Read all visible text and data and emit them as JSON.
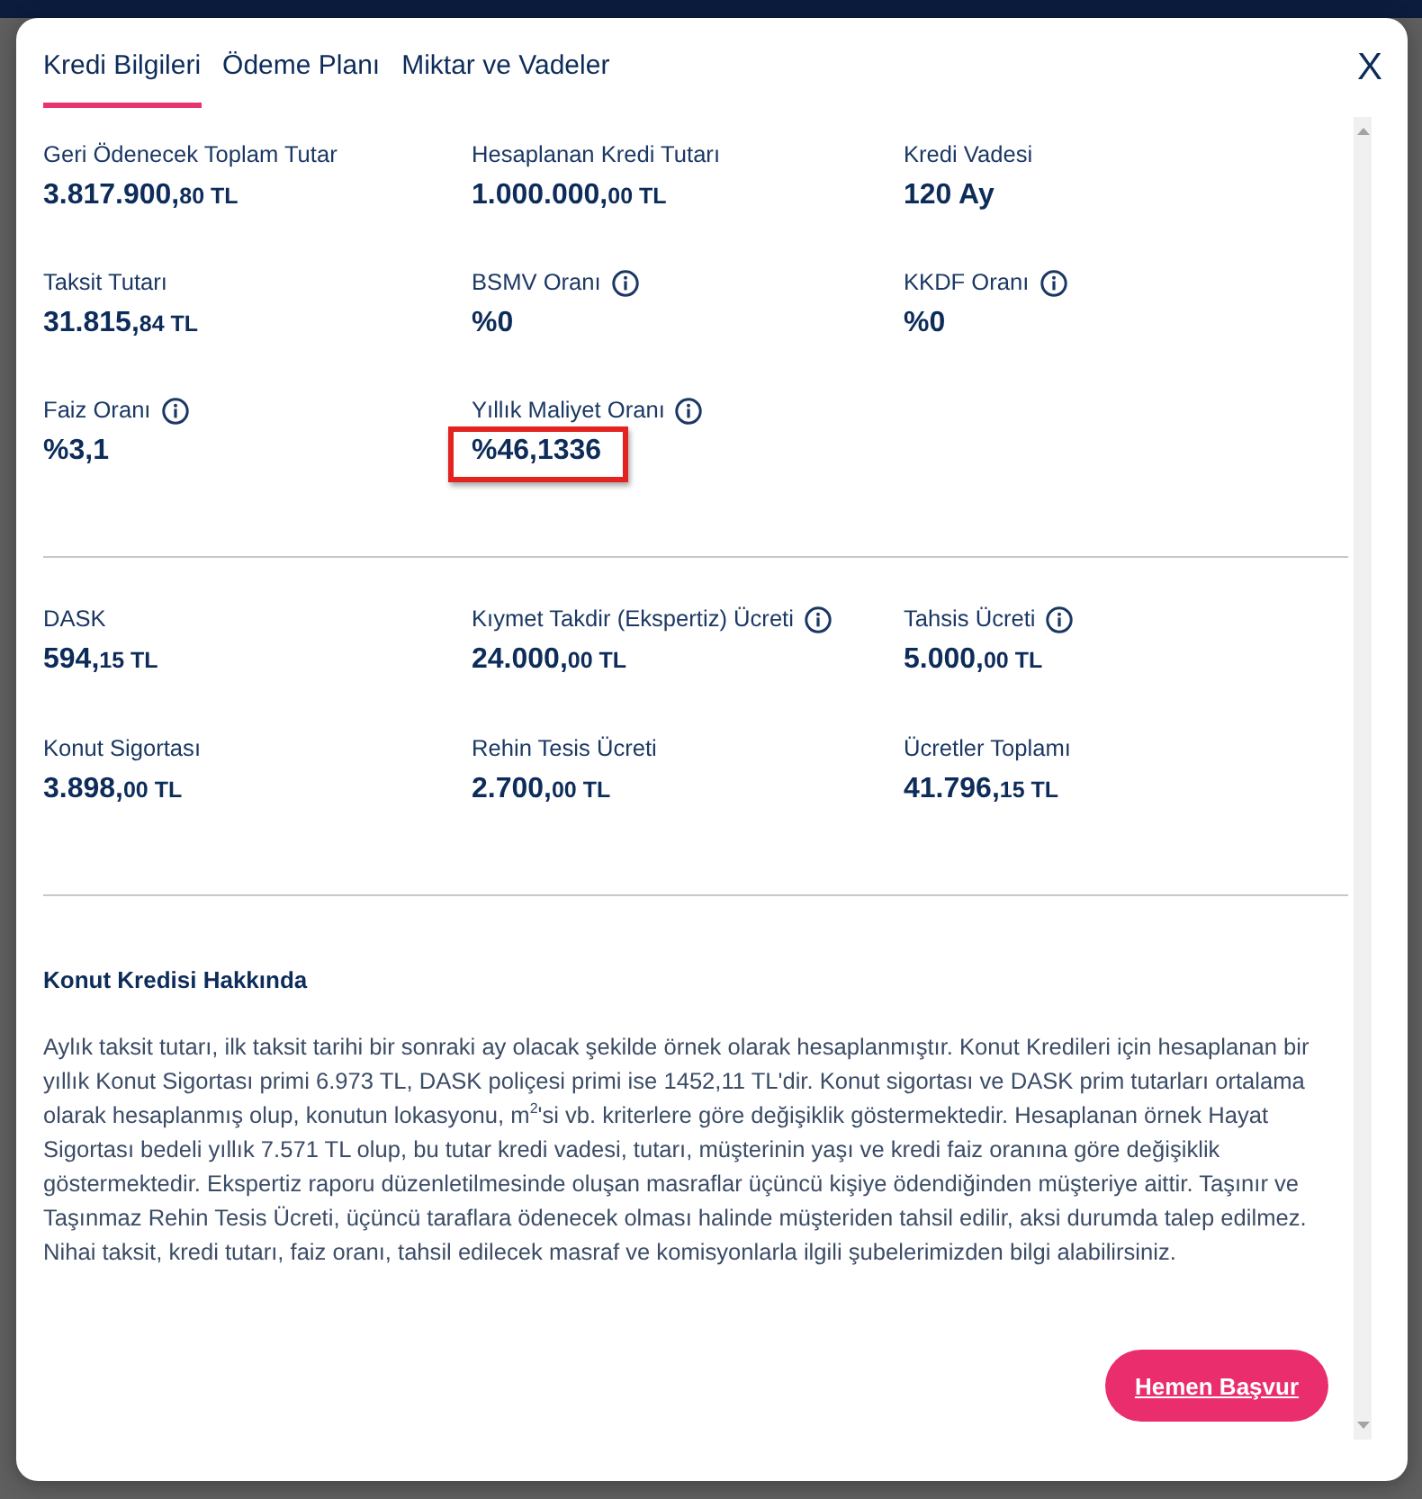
{
  "tabs": [
    {
      "label": "Kredi Bilgileri",
      "selected": true
    },
    {
      "label": "Ödeme Planı",
      "selected": false
    },
    {
      "label": "Miktar ve Vadeler",
      "selected": false
    }
  ],
  "close": "X",
  "sections": [
    {
      "items": [
        {
          "label": "Geri Ödenecek Toplam Tutar",
          "amount": "3.817.900,",
          "decimals": "80 TL"
        },
        {
          "label": "Hesaplanan Kredi Tutarı",
          "amount": "1.000.000,",
          "decimals": "00 TL"
        },
        {
          "label": "Kredi Vadesi",
          "amount": "120 Ay"
        },
        {
          "label": "Taksit Tutarı",
          "amount": "31.815,",
          "decimals": "84 TL"
        },
        {
          "label": "BSMV Oranı",
          "amount": "%0",
          "info": true
        },
        {
          "label": "KKDF Oranı",
          "amount": "%0",
          "info": true
        },
        {
          "label": "Faiz Oranı",
          "amount": "%3,1",
          "info": true
        },
        {
          "label": "Yıllık Maliyet Oranı",
          "amount": "%46,1336",
          "info": true,
          "highlighted": true
        }
      ]
    },
    {
      "items": [
        {
          "label": "DASK",
          "amount": "594,",
          "decimals": "15 TL"
        },
        {
          "label": "Kıymet Takdir (Ekspertiz) Ücreti",
          "amount": "24.000,",
          "decimals": "00 TL",
          "info": true
        },
        {
          "label": "Tahsis Ücreti",
          "amount": "5.000,",
          "decimals": "00 TL",
          "info": true
        },
        {
          "label": "Konut Sigortası",
          "amount": "3.898,",
          "decimals": "00 TL"
        },
        {
          "label": "Rehin Tesis Ücreti",
          "amount": "2.700,",
          "decimals": "00 TL"
        },
        {
          "label": "Ücretler Toplamı",
          "amount": "41.796,",
          "decimals": "15 TL"
        }
      ]
    }
  ],
  "about": {
    "title": "Konut Kredisi Hakkında",
    "text": "Aylık taksit tutarı, ilk taksit tarihi bir sonraki ay olacak şekilde örnek olarak hesaplanmıştır. Konut Kredileri için hesaplanan bir yıllık Konut Sigortası primi 6.973 TL, DASK poliçesi primi ise 1452,11 TL'dir. Konut sigortası ve DASK prim tutarları ortalama olarak hesaplanmış olup, konutun lokasyonu, m$^{2}$'si vb. kriterlere göre değişiklik göstermektedir. Hesaplanan örnek Hayat Sigortası bedeli yıllık 7.571 TL olup, bu tutar kredi vadesi, tutarı, müşterinin yaşı ve kredi faiz oranına göre değişiklik göstermektedir. Ekspertiz raporu düzenletilmesinde oluşan masraflar üçüncü kişiye ödendiğinden müşteriye aittir. Taşınır ve Taşınmaz Rehin Tesis Ücreti, üçüncü taraflara ödenecek olması halinde müşteriden tahsil edilir, aksi durumda talep edilmez. Nihai taksit, kredi tutarı, faiz oranı, tahsil edilecek masraf ve komisyonlarla ilgili şubelerimizden bilgi alabilirsiniz."
  },
  "apply_button": "Hemen Başvur"
}
